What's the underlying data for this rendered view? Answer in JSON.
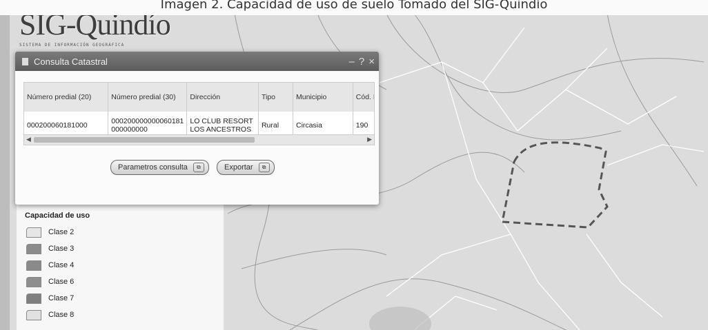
{
  "caption": "Imagen 2. Capacidad de uso de suelo Tomado del SIG-Quindío",
  "logo": {
    "title": "SIG-Quindío",
    "subtitle": "SISTEMA DE INFORMACIÓN GEOGRÁFICA"
  },
  "dialog": {
    "title": "Consulta Catastral",
    "controls": [
      "–",
      "?",
      "×"
    ],
    "table": {
      "headers": [
        "Número predial (20)",
        "Número predial (30)",
        "Dirección",
        "Tipo",
        "Municipio",
        "Cód. Muni"
      ],
      "rows": [
        [
          "000200060181000",
          "000200000000060181 000000000",
          "LO CLUB RESORT LOS ANCESTROS",
          "Rural",
          "Circasia",
          "190"
        ]
      ]
    },
    "buttons": {
      "params": "Parametros consulta",
      "export": "Exportar"
    }
  },
  "legend": {
    "title": "Capacidad de uso",
    "items": [
      {
        "label": "Clase 2",
        "color": "#e6e6e6"
      },
      {
        "label": "Clase 3",
        "color": "#8c8c8c"
      },
      {
        "label": "Clase 4",
        "color": "#8a8a8a"
      },
      {
        "label": "Clase 6",
        "color": "#8e8e8e"
      },
      {
        "label": "Clase 7",
        "color": "#7f7f7f"
      },
      {
        "label": "Clase 8",
        "color": "#e1e1e1"
      }
    ]
  }
}
